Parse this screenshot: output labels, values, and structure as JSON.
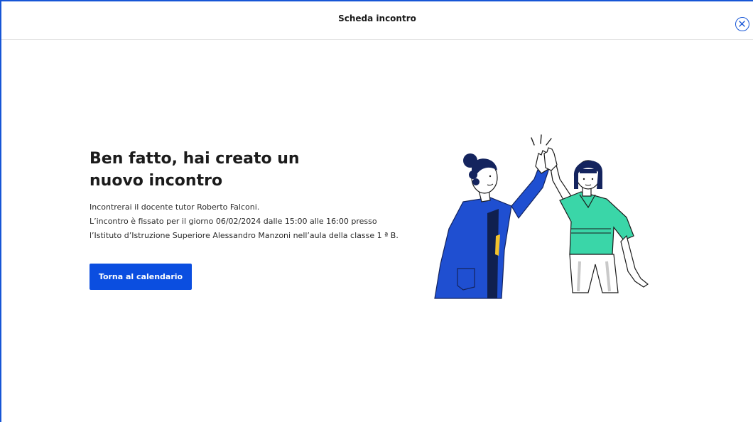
{
  "header": {
    "title": "Scheda incontro",
    "close_icon": "close-circle-icon"
  },
  "main": {
    "title": "Ben fatto, hai creato un nuovo incontro",
    "lines": [
      "Incontrerai il docente tutor Roberto Falconi.",
      "L’incontro è fissato per il giorno 06/02/2024 dalle 15:00 alle 16:00 presso",
      "l’Istituto d’Istruzione Superiore Alessandro Manzoni nell’aula della classe 1 ª B."
    ],
    "button_label": "Torna al calendario"
  },
  "illustration": {
    "icon": "high-five-illustration"
  },
  "colors": {
    "accent": "#0b4ee0",
    "border": "#1756d6",
    "coat": "#1f4fd1",
    "shirt": "#3ad6a8"
  }
}
